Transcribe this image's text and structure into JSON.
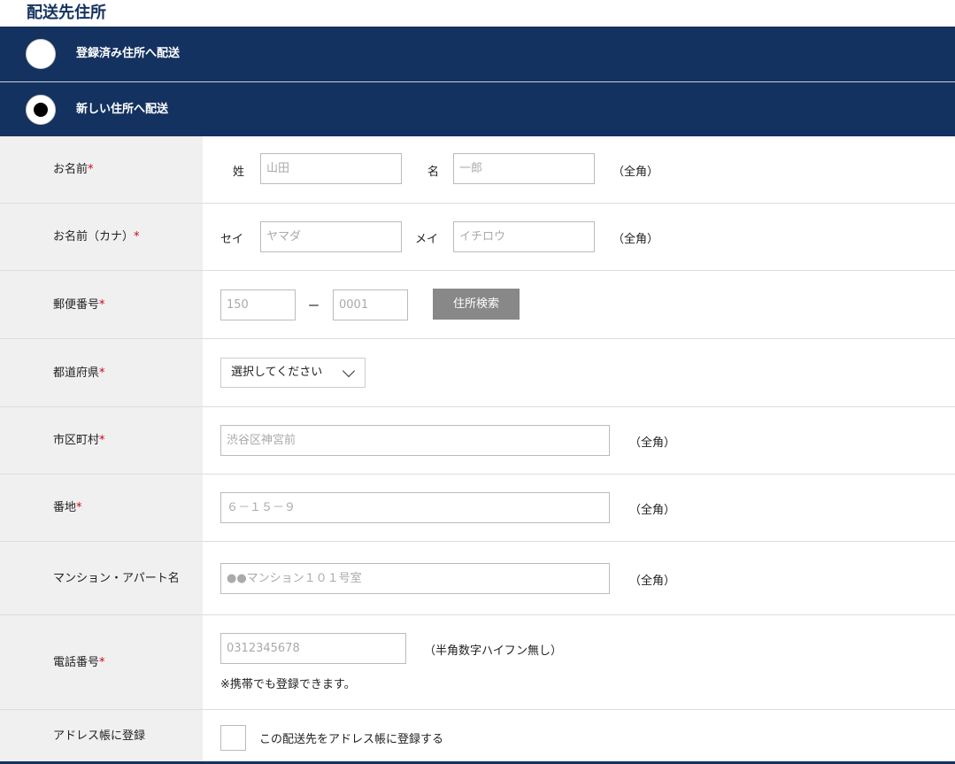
{
  "page_title": "配送先住所",
  "options": [
    {
      "label": "登録済み住所へ配送",
      "selected": false
    },
    {
      "label": "新しい住所へ配送",
      "selected": true
    }
  ],
  "required_mark": "*",
  "rows": {
    "name": {
      "label": "お名前",
      "sei_label": "姓",
      "sei_placeholder": "山田",
      "mei_label": "名",
      "mei_placeholder": "一郎",
      "note": "（全角）"
    },
    "kana": {
      "label": "お名前（カナ）",
      "sei_label": "セイ",
      "sei_placeholder": "ヤマダ",
      "mei_label": "メイ",
      "mei_placeholder": "イチロウ",
      "note": "（全角）"
    },
    "zip": {
      "label": "郵便番号",
      "first_placeholder": "150",
      "separator": "ー",
      "second_placeholder": "0001",
      "search_button": "住所検索"
    },
    "prefecture": {
      "label": "都道府県",
      "selected": "選択してください"
    },
    "city": {
      "label": "市区町村",
      "placeholder": "渋谷区神宮前",
      "note": "（全角）"
    },
    "street": {
      "label": "番地",
      "placeholder": "６－１５－９",
      "note": "（全角）"
    },
    "building": {
      "label": "マンション・アパート名",
      "placeholder": "●●マンション１０１号室",
      "note": "（全角）"
    },
    "phone": {
      "label": "電話番号",
      "placeholder": "0312345678",
      "note": "（半角数字ハイフン無し）",
      "sub_note": "※携帯でも登録できます。"
    },
    "address_book": {
      "label": "アドレス帳に登録",
      "checkbox_label": "この配送先をアドレス帳に登録する",
      "checked": false
    }
  }
}
